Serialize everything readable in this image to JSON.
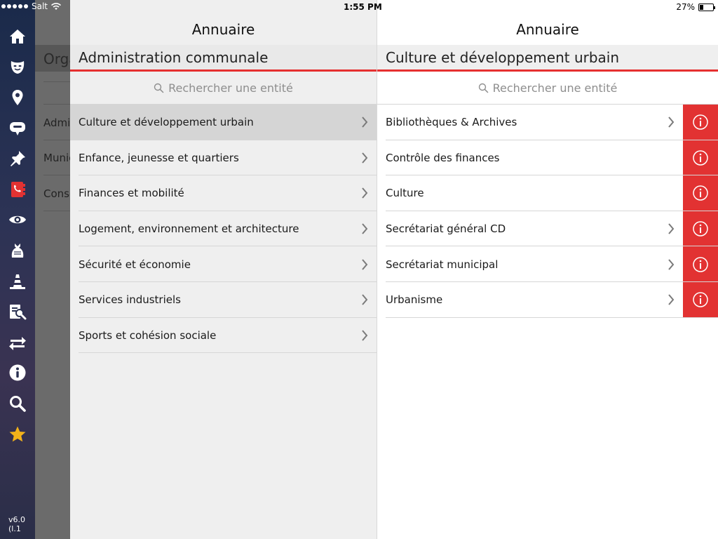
{
  "status_bar": {
    "carrier": "Salt",
    "time": "1:55 PM",
    "battery": "27%",
    "battery_level": 0.27
  },
  "sidebar": {
    "icons": [
      "home-icon",
      "theater-mask-icon",
      "map-pin-icon",
      "chat-bubble-icon",
      "pushpin-icon",
      "phone-book-icon",
      "eye-icon",
      "waste-bag-icon",
      "traffic-cone-icon",
      "document-search-icon",
      "swap-arrows-icon",
      "info-icon",
      "search-icon",
      "star-icon"
    ],
    "version": "v6.0 (l.1"
  },
  "background_panel": {
    "title": "Orga",
    "items": [
      "Admi",
      "Munic",
      "Conse"
    ]
  },
  "middle_panel": {
    "header": "Annuaire",
    "section_title": "Administration communale",
    "search_placeholder": "Rechercher une entité",
    "items": [
      "Culture et développement urbain",
      "Enfance, jeunesse et quartiers",
      "Finances et mobilité",
      "Logement, environnement et architecture",
      "Sécurité et économie",
      "Services industriels",
      "Sports et cohésion sociale"
    ],
    "selected_index": 0
  },
  "right_panel": {
    "header": "Annuaire",
    "section_title": "Culture et développement urbain",
    "search_placeholder": "Rechercher une entité",
    "items": [
      {
        "label": "Bibliothèques & Archives",
        "has_children": true
      },
      {
        "label": "Contrôle des finances",
        "has_children": false
      },
      {
        "label": "Culture",
        "has_children": false
      },
      {
        "label": "Secrétariat général CD",
        "has_children": true
      },
      {
        "label": "Secrétariat municipal",
        "has_children": true
      },
      {
        "label": "Urbanisme",
        "has_children": true
      }
    ]
  },
  "colors": {
    "accent": "#e23232",
    "star": "#f2b21a",
    "phone_book": "#e23232"
  }
}
